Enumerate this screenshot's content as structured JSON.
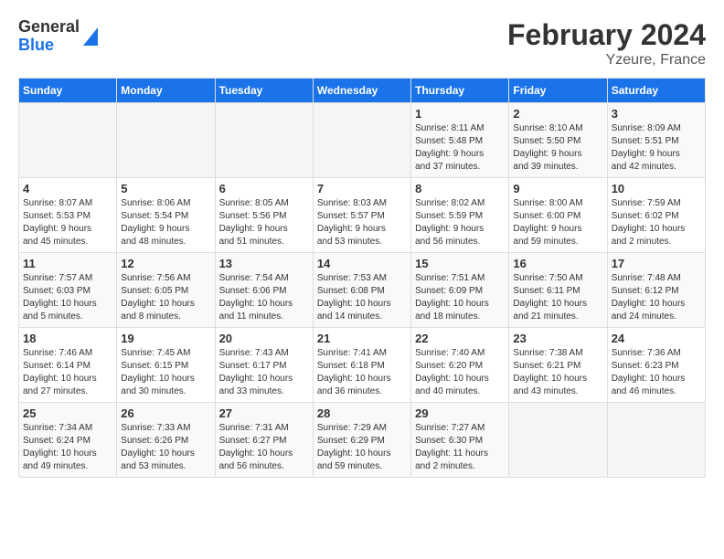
{
  "header": {
    "logo": {
      "line1": "General",
      "line2": "Blue"
    },
    "title": "February 2024",
    "subtitle": "Yzeure, France"
  },
  "weekdays": [
    "Sunday",
    "Monday",
    "Tuesday",
    "Wednesday",
    "Thursday",
    "Friday",
    "Saturday"
  ],
  "weeks": [
    [
      {
        "day": "",
        "info": ""
      },
      {
        "day": "",
        "info": ""
      },
      {
        "day": "",
        "info": ""
      },
      {
        "day": "",
        "info": ""
      },
      {
        "day": "1",
        "info": "Sunrise: 8:11 AM\nSunset: 5:48 PM\nDaylight: 9 hours\nand 37 minutes."
      },
      {
        "day": "2",
        "info": "Sunrise: 8:10 AM\nSunset: 5:50 PM\nDaylight: 9 hours\nand 39 minutes."
      },
      {
        "day": "3",
        "info": "Sunrise: 8:09 AM\nSunset: 5:51 PM\nDaylight: 9 hours\nand 42 minutes."
      }
    ],
    [
      {
        "day": "4",
        "info": "Sunrise: 8:07 AM\nSunset: 5:53 PM\nDaylight: 9 hours\nand 45 minutes."
      },
      {
        "day": "5",
        "info": "Sunrise: 8:06 AM\nSunset: 5:54 PM\nDaylight: 9 hours\nand 48 minutes."
      },
      {
        "day": "6",
        "info": "Sunrise: 8:05 AM\nSunset: 5:56 PM\nDaylight: 9 hours\nand 51 minutes."
      },
      {
        "day": "7",
        "info": "Sunrise: 8:03 AM\nSunset: 5:57 PM\nDaylight: 9 hours\nand 53 minutes."
      },
      {
        "day": "8",
        "info": "Sunrise: 8:02 AM\nSunset: 5:59 PM\nDaylight: 9 hours\nand 56 minutes."
      },
      {
        "day": "9",
        "info": "Sunrise: 8:00 AM\nSunset: 6:00 PM\nDaylight: 9 hours\nand 59 minutes."
      },
      {
        "day": "10",
        "info": "Sunrise: 7:59 AM\nSunset: 6:02 PM\nDaylight: 10 hours\nand 2 minutes."
      }
    ],
    [
      {
        "day": "11",
        "info": "Sunrise: 7:57 AM\nSunset: 6:03 PM\nDaylight: 10 hours\nand 5 minutes."
      },
      {
        "day": "12",
        "info": "Sunrise: 7:56 AM\nSunset: 6:05 PM\nDaylight: 10 hours\nand 8 minutes."
      },
      {
        "day": "13",
        "info": "Sunrise: 7:54 AM\nSunset: 6:06 PM\nDaylight: 10 hours\nand 11 minutes."
      },
      {
        "day": "14",
        "info": "Sunrise: 7:53 AM\nSunset: 6:08 PM\nDaylight: 10 hours\nand 14 minutes."
      },
      {
        "day": "15",
        "info": "Sunrise: 7:51 AM\nSunset: 6:09 PM\nDaylight: 10 hours\nand 18 minutes."
      },
      {
        "day": "16",
        "info": "Sunrise: 7:50 AM\nSunset: 6:11 PM\nDaylight: 10 hours\nand 21 minutes."
      },
      {
        "day": "17",
        "info": "Sunrise: 7:48 AM\nSunset: 6:12 PM\nDaylight: 10 hours\nand 24 minutes."
      }
    ],
    [
      {
        "day": "18",
        "info": "Sunrise: 7:46 AM\nSunset: 6:14 PM\nDaylight: 10 hours\nand 27 minutes."
      },
      {
        "day": "19",
        "info": "Sunrise: 7:45 AM\nSunset: 6:15 PM\nDaylight: 10 hours\nand 30 minutes."
      },
      {
        "day": "20",
        "info": "Sunrise: 7:43 AM\nSunset: 6:17 PM\nDaylight: 10 hours\nand 33 minutes."
      },
      {
        "day": "21",
        "info": "Sunrise: 7:41 AM\nSunset: 6:18 PM\nDaylight: 10 hours\nand 36 minutes."
      },
      {
        "day": "22",
        "info": "Sunrise: 7:40 AM\nSunset: 6:20 PM\nDaylight: 10 hours\nand 40 minutes."
      },
      {
        "day": "23",
        "info": "Sunrise: 7:38 AM\nSunset: 6:21 PM\nDaylight: 10 hours\nand 43 minutes."
      },
      {
        "day": "24",
        "info": "Sunrise: 7:36 AM\nSunset: 6:23 PM\nDaylight: 10 hours\nand 46 minutes."
      }
    ],
    [
      {
        "day": "25",
        "info": "Sunrise: 7:34 AM\nSunset: 6:24 PM\nDaylight: 10 hours\nand 49 minutes."
      },
      {
        "day": "26",
        "info": "Sunrise: 7:33 AM\nSunset: 6:26 PM\nDaylight: 10 hours\nand 53 minutes."
      },
      {
        "day": "27",
        "info": "Sunrise: 7:31 AM\nSunset: 6:27 PM\nDaylight: 10 hours\nand 56 minutes."
      },
      {
        "day": "28",
        "info": "Sunrise: 7:29 AM\nSunset: 6:29 PM\nDaylight: 10 hours\nand 59 minutes."
      },
      {
        "day": "29",
        "info": "Sunrise: 7:27 AM\nSunset: 6:30 PM\nDaylight: 11 hours\nand 2 minutes."
      },
      {
        "day": "",
        "info": ""
      },
      {
        "day": "",
        "info": ""
      }
    ]
  ]
}
